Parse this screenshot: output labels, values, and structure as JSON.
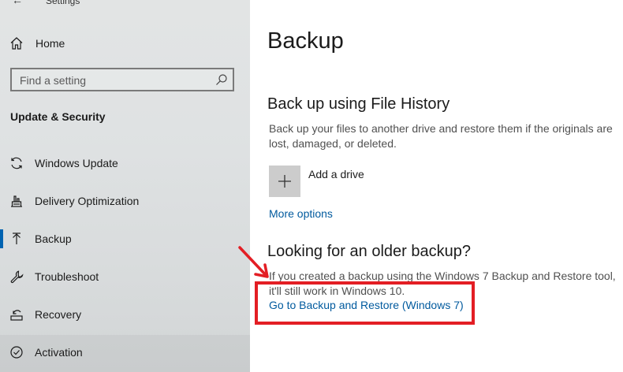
{
  "app": {
    "title": "Settings"
  },
  "sidebar": {
    "home_label": "Home",
    "search": {
      "placeholder": "Find a setting",
      "value": ""
    },
    "section_heading": "Update & Security",
    "items": [
      {
        "label": "Windows Update",
        "icon": "sync-icon"
      },
      {
        "label": "Delivery Optimization",
        "icon": "delivery-optimization-icon"
      },
      {
        "label": "Backup",
        "icon": "backup-arrow-icon",
        "selected": true
      },
      {
        "label": "Troubleshoot",
        "icon": "wrench-icon"
      },
      {
        "label": "Recovery",
        "icon": "recovery-icon"
      },
      {
        "label": "Activation",
        "icon": "check-circle-icon"
      }
    ],
    "accent_color": "#0063b1"
  },
  "main": {
    "page_title": "Backup",
    "file_history": {
      "title": "Back up using File History",
      "description": "Back up your files to another drive and restore them if the originals are lost, damaged, or deleted.",
      "add_drive_label": "Add a drive",
      "more_options_label": "More options"
    },
    "older_backup": {
      "title": "Looking for an older backup?",
      "description": "If you created a backup using the Windows 7 Backup and Restore tool, it'll still work in Windows 10.",
      "link_label": "Go to Backup and Restore (Windows 7)"
    },
    "link_color": "#005a9e"
  },
  "annotation": {
    "highlight_color": "#e31e24"
  }
}
